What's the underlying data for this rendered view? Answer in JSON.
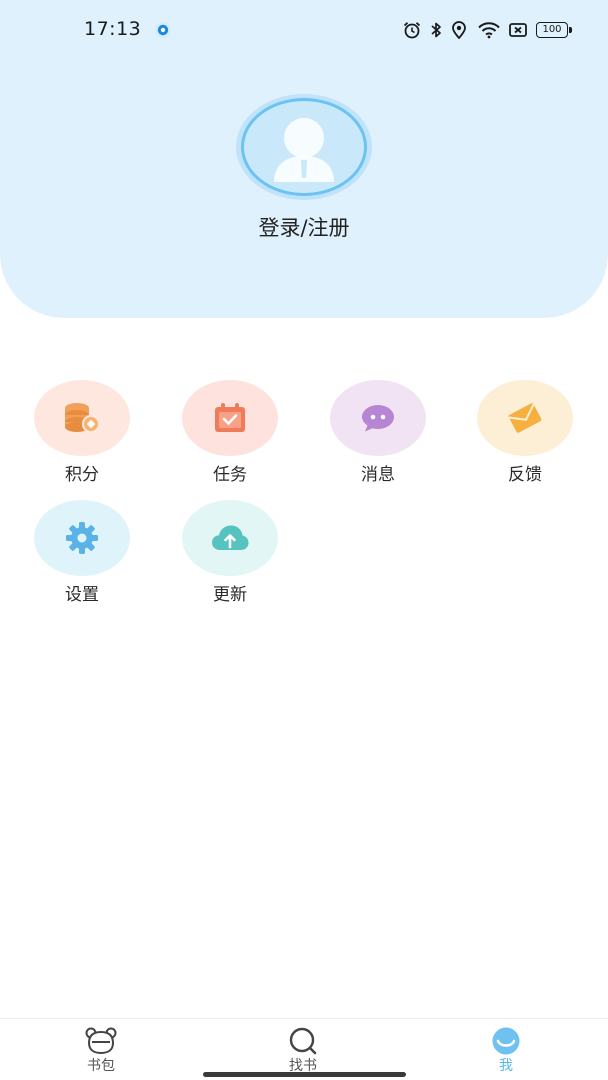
{
  "status_bar": {
    "time": "17:13",
    "battery": "100",
    "icons": [
      "alarm-icon",
      "bluetooth-icon",
      "location-icon",
      "wifi-icon",
      "sim-off-icon",
      "battery-icon"
    ]
  },
  "profile": {
    "login_label": "登录/注册"
  },
  "menu": {
    "points": "积分",
    "tasks": "任务",
    "messages": "消息",
    "feedback": "反馈",
    "settings": "设置",
    "update": "更新"
  },
  "bottom_nav": {
    "bookshelf": "书包",
    "find_books": "找书",
    "me": "我"
  },
  "colors": {
    "header_bg": "#dff1fd",
    "accent": "#59b8ee",
    "points_bg": "#fde7de",
    "tasks_bg": "#fde2de",
    "messages_bg": "#f1e3f3",
    "feedback_bg": "#fdeed6",
    "settings_bg": "#dff3fb",
    "update_bg": "#e2f6f6"
  }
}
